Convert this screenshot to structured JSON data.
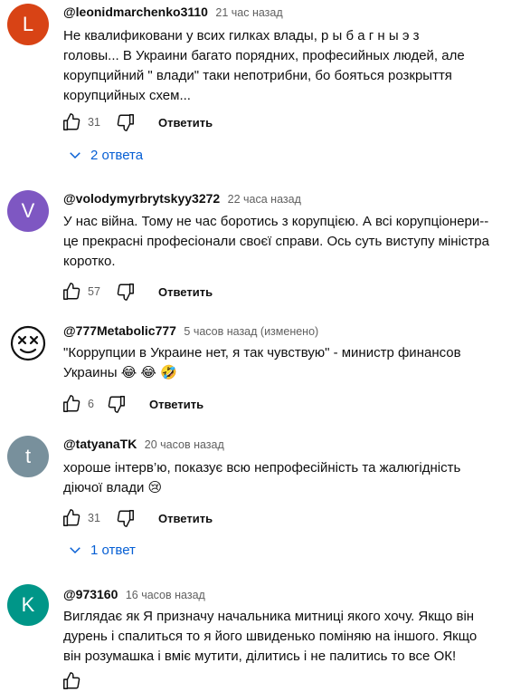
{
  "comments": [
    {
      "avatar_letter": "L",
      "avatar_color": "#d84315",
      "author": "@leonidmarchenko3110",
      "time": "21 час назад",
      "lines": [
        "Не квалификовани у всих гилках влады, р ы б а   г н ы э    з",
        "головы...  В  Украини  багато порядних, професийных людей, але",
        "корупцийний \" влади\" таки  непотрибни, бо бояться розкрыття",
        "корупцийных схем..."
      ],
      "likes": "31",
      "reply_label": "Ответить",
      "replies_label": "2 ответа"
    },
    {
      "avatar_letter": "V",
      "avatar_color": "#7e57c2",
      "author": "@volodymyrbrytskyy3272",
      "time": "22 часа назад",
      "lines": [
        "У нас війна. Тому не час боротись з корупцією. А всі корупціонери--",
        "це прекрасні професіонали своєї справи. Ось суть виступу міністра",
        "коротко."
      ],
      "likes": "57",
      "reply_label": "Ответить"
    },
    {
      "avatar_icon": "dizzy-face-icon",
      "author": "@777Metabolic777",
      "time": "5 часов назад (изменено)",
      "lines": [
        "\"Коррупции в Украине нет, я так чувствую\" - министр финансов",
        "Украины 😂 😂 🤣"
      ],
      "likes": "6",
      "reply_label": "Ответить"
    },
    {
      "avatar_letter": "t",
      "avatar_color": "#78909c",
      "author": "@tatyanaTK",
      "time": "20 часов назад",
      "lines": [
        "хороше інтерв’ю, показує всю непрофесійність та жалюгідність",
        "діючої влади 😢"
      ],
      "likes": "31",
      "reply_label": "Ответить",
      "replies_label": "1 ответ"
    },
    {
      "avatar_letter": "K",
      "avatar_color": "#009688",
      "author": "@973160",
      "time": "16 часов назад",
      "lines": [
        "Виглядає як Я призначу начальника митниці якого хочу. Якщо він",
        "дурень і спалиться то я його швиденько поміняю на іншого. Якщо",
        "він розумашка і вміє мутити, ділитись і не палитись то все ОК!"
      ]
    }
  ]
}
